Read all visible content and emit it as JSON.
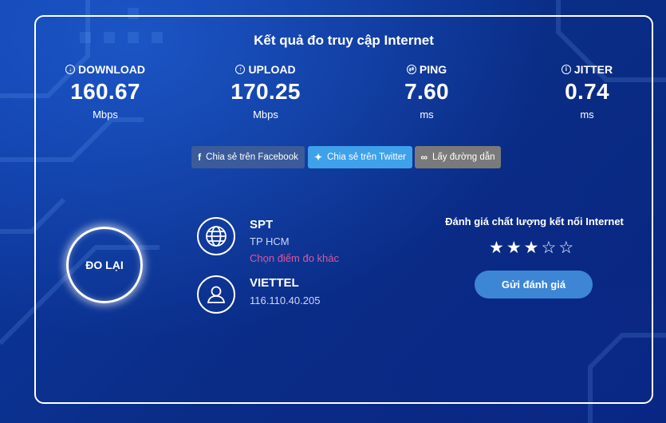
{
  "title": "Kết quả đo truy cập Internet",
  "metrics": [
    {
      "label": "DOWNLOAD",
      "icon": "arrow-down-circle-icon",
      "value": "160.67",
      "unit": "Mbps"
    },
    {
      "label": "UPLOAD",
      "icon": "arrow-up-circle-icon",
      "value": "170.25",
      "unit": "Mbps"
    },
    {
      "label": "PING",
      "icon": "ping-icon",
      "value": "7.60",
      "unit": "ms"
    },
    {
      "label": "JITTER",
      "icon": "info-circle-icon",
      "value": "0.74",
      "unit": "ms"
    }
  ],
  "share": {
    "facebook": "Chia sẻ trên Facebook",
    "twitter": "Chia sẻ trên Twitter",
    "link": "Lấy đường dẫn"
  },
  "retest_label": "ĐO LẠI",
  "server": {
    "name": "SPT",
    "location": "TP HCM",
    "change_link": "Chọn điểm đo khác"
  },
  "client": {
    "isp": "VIETTEL",
    "ip": "116.110.40.205"
  },
  "rating": {
    "title": "Đánh giá chất lượng kết nối Internet",
    "stars_filled": 3,
    "stars_total": 5,
    "submit_label": "Gửi đánh giá"
  },
  "colors": {
    "background": "#0a2e8c",
    "facebook": "#3b5b9a",
    "twitter": "#3ea1ea",
    "link_button": "#7a7a7a",
    "change_link": "#e0559b",
    "submit": "#3d86d6"
  }
}
